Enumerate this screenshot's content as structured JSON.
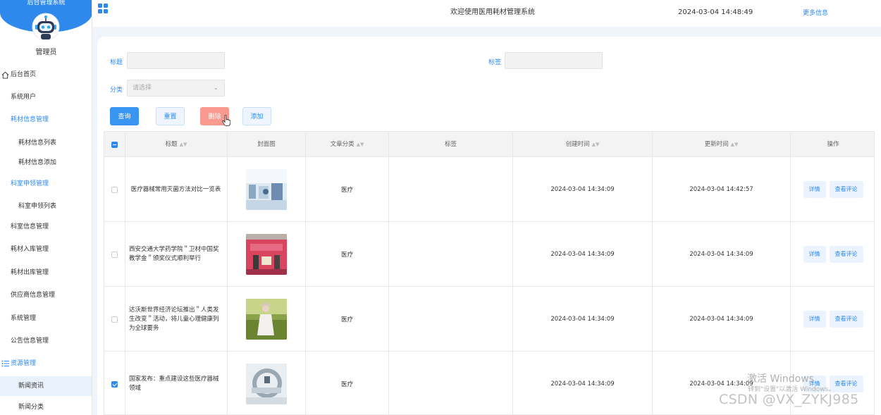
{
  "sidebar": {
    "system_name": "后台管理系统",
    "user": "管理员",
    "items": [
      {
        "label": "后台首页"
      },
      {
        "label": "系统用户"
      },
      {
        "label": "耗材信息管理"
      },
      {
        "label": "耗材信息列表"
      },
      {
        "label": "耗材信息添加"
      },
      {
        "label": "科室申领管理"
      },
      {
        "label": "科室申领列表"
      },
      {
        "label": "科室信息管理"
      },
      {
        "label": "耗材入库管理"
      },
      {
        "label": "耗材出库管理"
      },
      {
        "label": "供应商信息管理"
      },
      {
        "label": "系统管理"
      },
      {
        "label": "公告信息管理"
      },
      {
        "label": "资源管理"
      },
      {
        "label": "新闻资讯"
      },
      {
        "label": "新闻分类"
      }
    ]
  },
  "header": {
    "welcome": "欢迎使用医用耗材管理系统",
    "datetime": "2024-03-04 14:48:49",
    "more": "更多信息"
  },
  "filters": {
    "title_label": "标题",
    "tag_label": "标签",
    "category_label": "分类",
    "category_placeholder": "请选择"
  },
  "buttons": {
    "query": "查询",
    "reset": "重置",
    "delete": "删除",
    "add": "添加"
  },
  "table": {
    "columns": [
      "标题",
      "封面图",
      "文章分类",
      "标签",
      "创建时间",
      "更新时间",
      "操作"
    ],
    "rows": [
      {
        "title": "医疗器械常用灭菌方法对比一览表",
        "category": "医疗",
        "tag": "",
        "created": "2024-03-04 14:34:09",
        "updated": "2024-03-04 14:42:57",
        "checked": false
      },
      {
        "title": "西安交通大学药学院＂卫材中国奖教学金＂颁奖仪式顺利举行",
        "category": "医疗",
        "tag": "",
        "created": "2024-03-04 14:34:09",
        "updated": "2024-03-04 14:34:09",
        "checked": false
      },
      {
        "title": "达沃斯世界经济论坛推出＂人类发生改变＂活动，将儿童心理健康列为全球要务",
        "category": "医疗",
        "tag": "",
        "created": "2024-03-04 14:34:09",
        "updated": "2024-03-04 14:34:09",
        "checked": false
      },
      {
        "title": "国家发布：重点建设这些医疗器械领域",
        "category": "医疗",
        "tag": "",
        "created": "2024-03-04 14:34:09",
        "updated": "2024-03-04 14:34:09",
        "checked": true
      }
    ],
    "op_detail": "详情",
    "op_comments": "查看评论"
  },
  "watermarks": {
    "win_line1": "激活 Windows",
    "win_line2": "转到\"设置\"以激活 Windows。",
    "csdn": "CSDN @VX_ZYKJ985"
  },
  "colors": {
    "primary": "#2f89ec",
    "danger": "#f89a8f"
  }
}
